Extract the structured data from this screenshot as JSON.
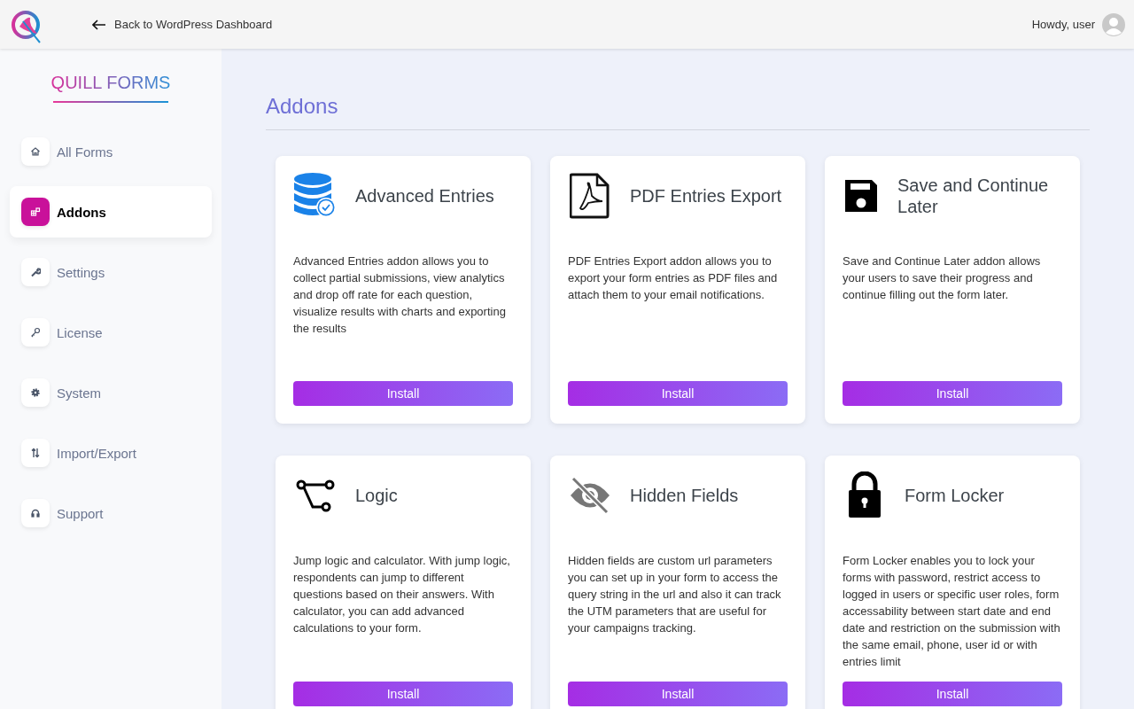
{
  "topbar": {
    "back_link": "Back to WordPress Dashboard",
    "greeting": "Howdy, user"
  },
  "sidebar": {
    "brand": "QUILL FORMS",
    "items": [
      {
        "label": "All Forms",
        "selected": false
      },
      {
        "label": "Addons",
        "selected": true
      },
      {
        "label": "Settings",
        "selected": false
      },
      {
        "label": "License",
        "selected": false
      },
      {
        "label": "System",
        "selected": false
      },
      {
        "label": "Import/Export",
        "selected": false
      },
      {
        "label": "Support",
        "selected": false
      }
    ]
  },
  "page": {
    "title": "Addons"
  },
  "addons": [
    {
      "title": "Advanced Entries",
      "description": "Advanced Entries addon allows you to collect partial submissions, view analytics and drop off rate for each question, visualize results with charts and exporting the results",
      "button": "Install"
    },
    {
      "title": "PDF Entries Export",
      "description": "PDF Entries Export addon allows you to export your form entries as PDF files and attach them to your email notifications.",
      "button": "Install"
    },
    {
      "title": "Save and Continue Later",
      "description": "Save and Continue Later addon allows your users to save their progress and continue filling out the form later.",
      "button": "Install"
    },
    {
      "title": "Logic",
      "description": "Jump logic and calculator. With jump logic, respondents can jump to different questions based on their answers. With calculator, you can add advanced calculations to your form.",
      "button": "Install"
    },
    {
      "title": "Hidden Fields",
      "description": "Hidden fields are custom url parameters you can set up in your form to access the query string in the url and also it can track the UTM parameters that are useful for your campaigns tracking.",
      "button": "Install"
    },
    {
      "title": "Form Locker",
      "description": "Form Locker enables you to lock your forms with password, restrict access to logged in users or specific user roles, form accessability between start date and end date and restriction on the submission with the same email, phone, user id or with entries limit",
      "button": "Install"
    }
  ]
}
